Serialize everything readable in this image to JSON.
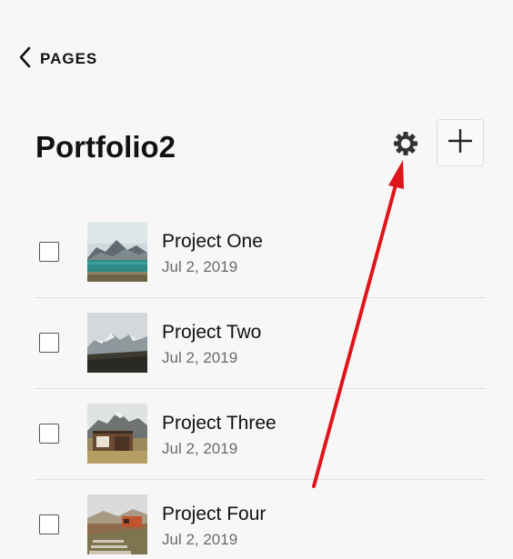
{
  "header": {
    "back_label": "PAGES",
    "title": "Portfolio2"
  },
  "icons": {
    "back": "chevron-left-icon",
    "settings": "gear-icon",
    "add": "plus-icon"
  },
  "items": [
    {
      "title": "Project One",
      "date": "Jul 2, 2019"
    },
    {
      "title": "Project Two",
      "date": "Jul 2, 2019"
    },
    {
      "title": "Project Three",
      "date": "Jul 2, 2019"
    },
    {
      "title": "Project Four",
      "date": "Jul 2, 2019"
    }
  ],
  "colors": {
    "background": "#f7f7f7",
    "annotation_arrow": "#e0141b"
  }
}
